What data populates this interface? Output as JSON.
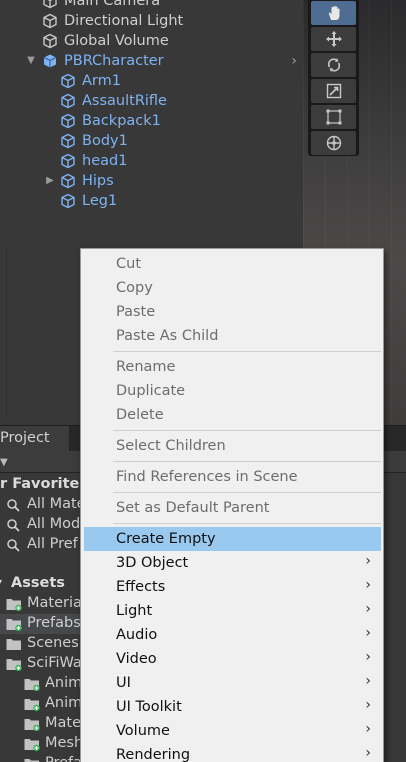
{
  "hierarchy": {
    "items": [
      {
        "label": "Main Camera",
        "kind": "gameobject"
      },
      {
        "label": "Directional Light",
        "kind": "gameobject"
      },
      {
        "label": "Global Volume",
        "kind": "gameobject"
      },
      {
        "label": "PBRCharacter",
        "kind": "prefab-root",
        "expanded": true
      },
      {
        "label": "Arm1",
        "kind": "prefab"
      },
      {
        "label": "AssaultRifle",
        "kind": "prefab"
      },
      {
        "label": "Backpack1",
        "kind": "prefab"
      },
      {
        "label": "Body1",
        "kind": "prefab"
      },
      {
        "label": "head1",
        "kind": "prefab"
      },
      {
        "label": "Hips",
        "kind": "prefab",
        "collapsed": true
      },
      {
        "label": "Leg1",
        "kind": "prefab"
      }
    ]
  },
  "scene_tools": [
    "hand-tool",
    "move-tool",
    "rotate-tool",
    "scale-tool",
    "rect-tool",
    "transform-tool"
  ],
  "project": {
    "tab_label": "Project",
    "favorites": {
      "header": "r Favorites",
      "items": [
        "All Mate",
        "All Mod",
        "All Pref"
      ]
    },
    "assets": {
      "header": "Assets",
      "folders": [
        {
          "label": "Materia",
          "indent": 0
        },
        {
          "label": "Prefabs",
          "indent": 0
        },
        {
          "label": "Scenes",
          "indent": 0
        },
        {
          "label": "SciFiWa",
          "indent": 0
        },
        {
          "label": "Anim",
          "indent": 1
        },
        {
          "label": "Anim",
          "indent": 1
        },
        {
          "label": "Mate",
          "indent": 1
        },
        {
          "label": "Mesh",
          "indent": 1
        },
        {
          "label": "Prefa",
          "indent": 1
        }
      ]
    }
  },
  "context_menu": {
    "groups": [
      [
        {
          "label": "Cut",
          "enabled": false
        },
        {
          "label": "Copy",
          "enabled": false
        },
        {
          "label": "Paste",
          "enabled": false
        },
        {
          "label": "Paste As Child",
          "enabled": false
        }
      ],
      [
        {
          "label": "Rename",
          "enabled": false
        },
        {
          "label": "Duplicate",
          "enabled": false
        },
        {
          "label": "Delete",
          "enabled": false
        }
      ],
      [
        {
          "label": "Select Children",
          "enabled": false
        }
      ],
      [
        {
          "label": "Find References in Scene",
          "enabled": false
        }
      ],
      [
        {
          "label": "Set as Default Parent",
          "enabled": false
        }
      ],
      [
        {
          "label": "Create Empty",
          "enabled": true,
          "highlighted": true
        },
        {
          "label": "3D Object",
          "enabled": true,
          "submenu": true
        },
        {
          "label": "Effects",
          "enabled": true,
          "submenu": true
        },
        {
          "label": "Light",
          "enabled": true,
          "submenu": true
        },
        {
          "label": "Audio",
          "enabled": true,
          "submenu": true
        },
        {
          "label": "Video",
          "enabled": true,
          "submenu": true
        },
        {
          "label": "UI",
          "enabled": true,
          "submenu": true
        },
        {
          "label": "UI Toolkit",
          "enabled": true,
          "submenu": true
        },
        {
          "label": "Volume",
          "enabled": true,
          "submenu": true
        },
        {
          "label": "Rendering",
          "enabled": true,
          "submenu": true
        }
      ]
    ]
  },
  "colors": {
    "prefab_text": "#7fb2f0",
    "menu_highlight": "#99c9ef",
    "active_tool": "#4f6c92"
  }
}
